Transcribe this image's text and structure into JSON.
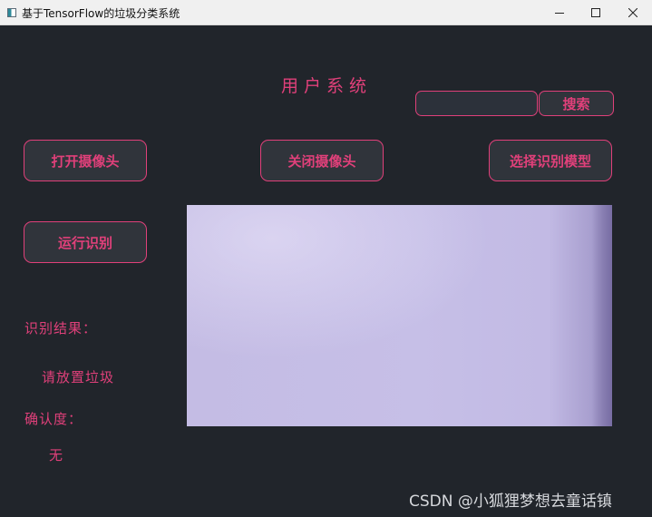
{
  "window": {
    "title": "基于TensorFlow的垃圾分类系统",
    "icon": "app-icon",
    "controls": {
      "minimize_icon": "minimize-icon",
      "maximize_icon": "maximize-icon",
      "close_icon": "close-icon"
    }
  },
  "header": {
    "title": "用户系统"
  },
  "search": {
    "value": "",
    "placeholder": "",
    "button_label": "搜索"
  },
  "toolbar": {
    "open_camera_label": "打开摄像头",
    "close_camera_label": "关闭摄像头",
    "select_model_label": "选择识别模型",
    "run_label": "运行识别"
  },
  "camera": {
    "state": "live-feed"
  },
  "results": {
    "result_label": "识别结果：",
    "result_value": "请放置垃圾",
    "confidence_label": "确认度：",
    "confidence_value": "无"
  },
  "watermark": {
    "text": "CSDN @小狐狸梦想去童话镇"
  },
  "colors": {
    "background": "#21252b",
    "accent": "#e0407a",
    "button_background": "#30343b",
    "titlebar": "#f0f0f0"
  }
}
